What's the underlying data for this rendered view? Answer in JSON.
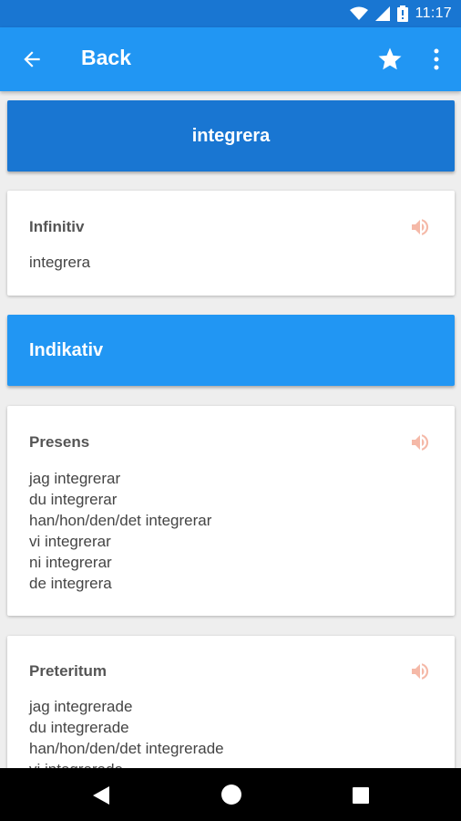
{
  "status_bar": {
    "time": "11:17"
  },
  "app_bar": {
    "title": "Back"
  },
  "verb": {
    "word": "integrera"
  },
  "infinitive_card": {
    "title": "Infinitiv",
    "lines": [
      "integrera"
    ]
  },
  "section": {
    "title": "Indikativ"
  },
  "presens_card": {
    "title": "Presens",
    "lines": [
      "jag integrerar",
      "du integrerar",
      "han/hon/den/det integrerar",
      "vi integrerar",
      "ni integrerar",
      "de integrera"
    ]
  },
  "preteritum_card": {
    "title": "Preteritum",
    "lines": [
      "jag integrerade",
      "du integrerade",
      "han/hon/den/det integrerade",
      "vi integrerade"
    ]
  },
  "colors": {
    "primary": "#2196f3",
    "primary_dark": "#1976d2",
    "speaker": "#f5b9a8"
  },
  "icons": {
    "back": "arrow-left-icon",
    "favorite": "star-icon",
    "overflow": "more-vert-icon",
    "audio": "speaker-icon"
  }
}
